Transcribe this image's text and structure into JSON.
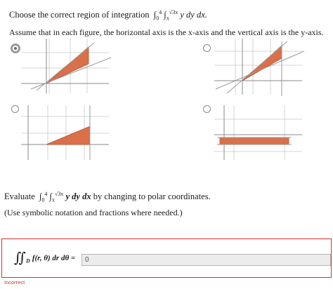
{
  "question1": {
    "prefix": "Choose the correct region of integration",
    "integral": {
      "outer_upper": "4",
      "outer_lower": "0",
      "inner_upper": "√3x",
      "inner_lower": "x",
      "integrand": "y dy dx."
    },
    "note": "Assume that in each figure, the horizontal axis is the x-axis and the vertical axis is the y-axis."
  },
  "options": [
    {
      "id": "A",
      "selected": true
    },
    {
      "id": "B",
      "selected": false
    },
    {
      "id": "C",
      "selected": false
    },
    {
      "id": "D",
      "selected": false
    }
  ],
  "colors": {
    "fill": "#d9704a",
    "fill_stroke": "#b4532f",
    "grid": "#c8c8c8",
    "axis": "#888888",
    "error": "#d9302c"
  },
  "question2": {
    "prefix": "Evaluate",
    "integral": {
      "outer_upper": "4",
      "outer_lower": "0",
      "inner_upper": "√3x",
      "inner_lower": "x",
      "integrand": "y dy dx"
    },
    "suffix": "by changing to polar coordinates.",
    "hint": "(Use symbolic notation and fractions where needed.)"
  },
  "answer": {
    "region_label": "D",
    "expression": "f(r, θ) dr dθ =",
    "value": "0",
    "status": "Incorrect"
  }
}
